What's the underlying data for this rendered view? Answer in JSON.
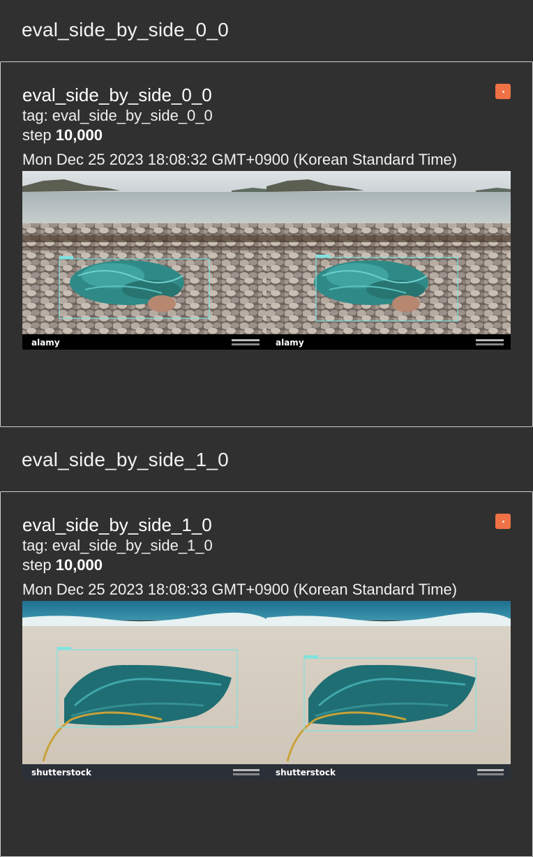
{
  "groups": [
    {
      "header_title": "eval_side_by_side_0_0",
      "card": {
        "title": "eval_side_by_side_0_0",
        "tag_label": "tag: eval_side_by_side_0_0",
        "step_prefix": "step",
        "step_value": "10,000",
        "timestamp": "Mon Dec 25 2023 18:08:32 GMT+0900 (Korean Standard Time)",
        "image": {
          "scene": "rocky-beach",
          "watermark": "alamy",
          "box_color": "#7fe3e0"
        }
      }
    },
    {
      "header_title": "eval_side_by_side_1_0",
      "card": {
        "title": "eval_side_by_side_1_0",
        "tag_label": "tag: eval_side_by_side_1_0",
        "step_prefix": "step",
        "step_value": "10,000",
        "timestamp": "Mon Dec 25 2023 18:08:33 GMT+0900 (Korean Standard Time)",
        "image": {
          "scene": "sandy-beach",
          "watermark": "shutterstock",
          "box_color": "#7fe3e0"
        }
      }
    }
  ],
  "colors": {
    "background": "#303030",
    "card_border": "#cfcfcf",
    "accent_orange": "#ef7146"
  }
}
